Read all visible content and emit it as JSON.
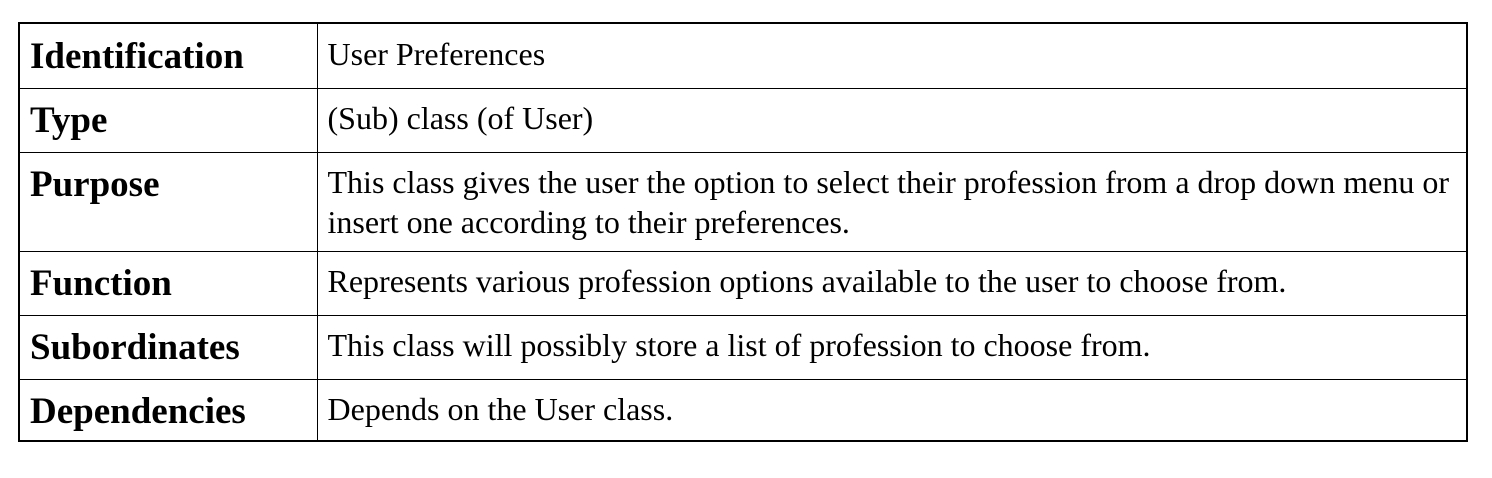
{
  "rows": [
    {
      "label": "Identification",
      "value": "User Preferences"
    },
    {
      "label": "Type",
      "value": "(Sub) class (of User)"
    },
    {
      "label": "Purpose",
      "value": "This class gives the user the option to select their profession from a drop down menu or insert one according to their preferences."
    },
    {
      "label": "Function",
      "value": "Represents various profession options available to the user to choose from."
    },
    {
      "label": "Subordinates",
      "value": "This class will possibly store a list of profession to choose from."
    },
    {
      "label": "Dependencies",
      "value": "Depends on the User class."
    }
  ]
}
